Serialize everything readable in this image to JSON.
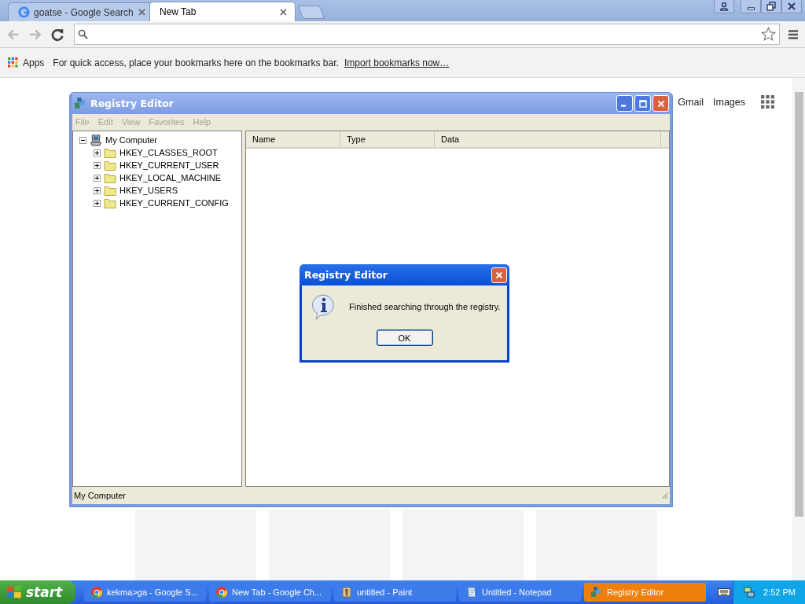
{
  "browser": {
    "tabs": [
      {
        "title": "goatse - Google Search",
        "selected": false,
        "favicon": true
      },
      {
        "title": "New Tab",
        "selected": true,
        "favicon": false
      }
    ],
    "bookmarks_bar": {
      "apps": "Apps",
      "hint": "For quick access, place your bookmarks here on the bookmarks bar.",
      "link": "Import bookmarks now…"
    },
    "page_links": [
      "Gmail",
      "Images"
    ]
  },
  "registry_editor": {
    "title": "Registry Editor",
    "menu": [
      {
        "label": "File",
        "disabled": true
      },
      {
        "label": "Edit",
        "disabled": true
      },
      {
        "label": "View",
        "disabled": true
      },
      {
        "label": "Favorites",
        "disabled": true
      },
      {
        "label": "Help",
        "disabled": true
      }
    ],
    "tree": {
      "label": "My Computer",
      "expanded": true,
      "children": [
        {
          "label": "HKEY_CLASSES_ROOT",
          "expanded": false
        },
        {
          "label": "HKEY_CURRENT_USER",
          "expanded": false
        },
        {
          "label": "HKEY_LOCAL_MACHINE",
          "expanded": false
        },
        {
          "label": "HKEY_USERS",
          "expanded": false
        },
        {
          "label": "HKEY_CURRENT_CONFIG",
          "expanded": false
        }
      ]
    },
    "columns": [
      "Name",
      "Type",
      "Data"
    ],
    "status_bar": "My Computer"
  },
  "dialog": {
    "title": "Registry Editor",
    "message": "Finished searching through the registry.",
    "button": "OK"
  },
  "taskbar": {
    "start": "start",
    "items": [
      {
        "label": "kekma>ga - Google S...",
        "kind": "chrome",
        "selected": false
      },
      {
        "label": "New Tab - Google Ch...",
        "kind": "chrome",
        "selected": false
      },
      {
        "label": "untitled - Paint",
        "kind": "paint",
        "selected": false
      },
      {
        "label": "Untitled - Notepad",
        "kind": "notepad",
        "selected": false
      },
      {
        "label": "Registry Editor",
        "kind": "regedit",
        "selected": true
      }
    ],
    "clock": "2:52 PM"
  }
}
